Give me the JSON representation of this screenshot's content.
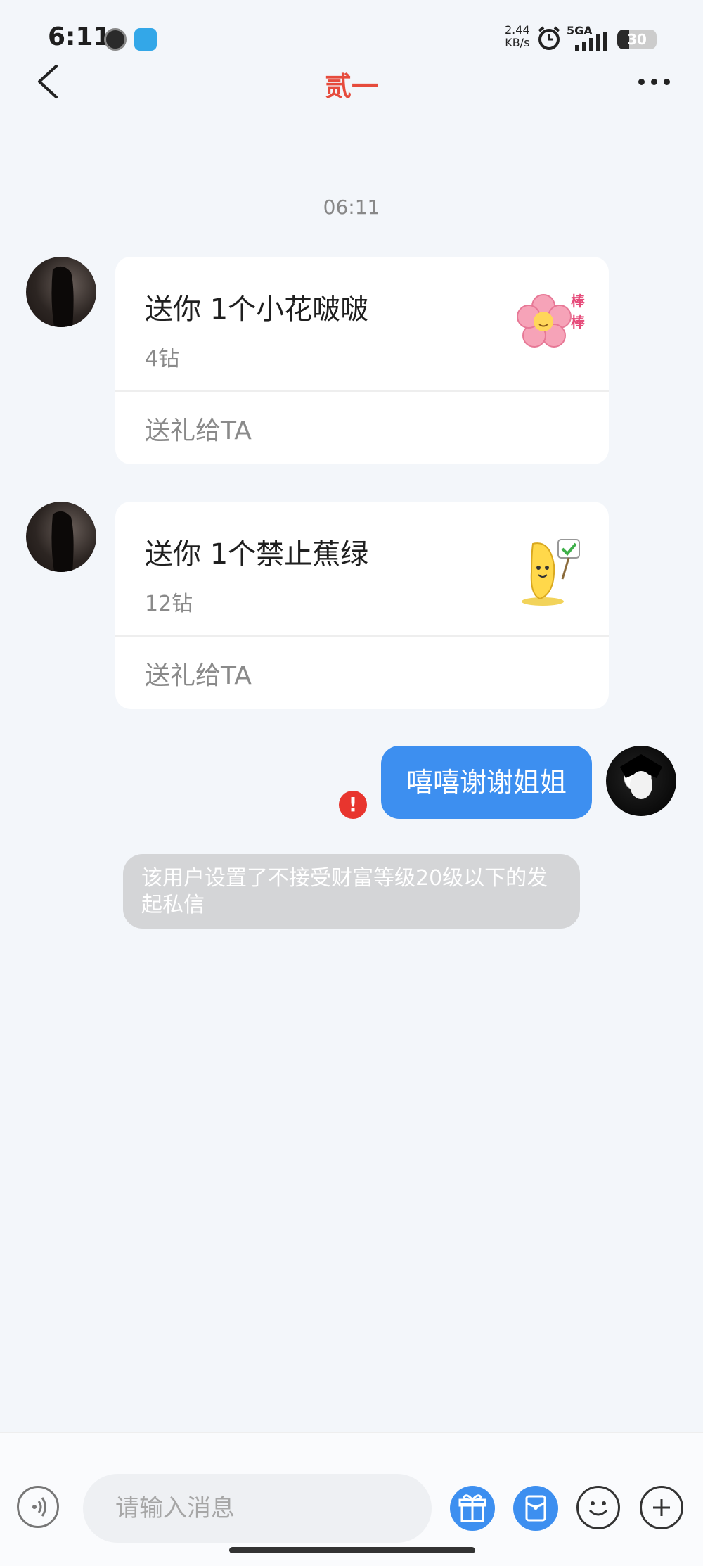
{
  "status_bar": {
    "time": "6:11",
    "speed_value": "2.44",
    "speed_unit": "KB/s",
    "network": "5GA",
    "battery": "30",
    "battery_level": 0.3
  },
  "header": {
    "title": "贰一"
  },
  "chat": {
    "timestamp": "06:11",
    "gifts": [
      {
        "title": "送你 1个小花啵啵",
        "price": "4钻",
        "action": "送礼给TA",
        "image_icon": "flower-sticker"
      },
      {
        "title": "送你 1个禁止蕉绿",
        "price": "12钻",
        "action": "送礼给TA",
        "image_icon": "banana-sticker"
      }
    ],
    "outgoing_message": "嘻嘻谢谢姐姐",
    "error_mark": "!",
    "system_notice": "该用户设置了不接受财富等级20级以下的发起私信"
  },
  "input_bar": {
    "placeholder": "请输入消息"
  },
  "colors": {
    "title_red": "#e64b3c",
    "bubble_blue": "#3d8ff0",
    "error_red": "#e8352e",
    "background": "#f3f6fa"
  }
}
